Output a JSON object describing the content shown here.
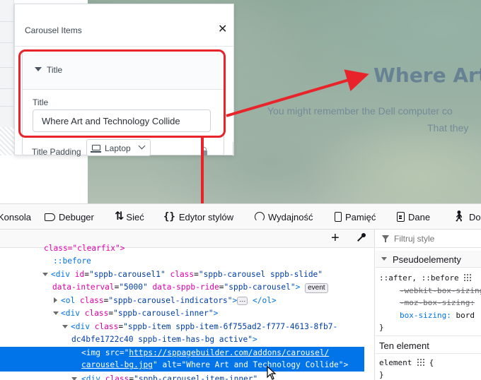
{
  "preview": {
    "hero_title": "Where Art a",
    "hero_sub_1": "You might remember the Dell computer co",
    "hero_sub_2": "That they"
  },
  "panel": {
    "title": "Carousel Items",
    "close_icon": "close-icon",
    "group_label": "Title",
    "field_label": "Title",
    "title_value": "Where Art and Technology Collide",
    "padding_label": "Title Padding",
    "device_label": "Laptop"
  },
  "colors": {
    "highlight_red": "#e8232a",
    "selection_blue": "#0074e8",
    "tag_blue": "#0074e8",
    "attr_pink": "#dd00a9",
    "value_navy": "#003eaa"
  },
  "devtools": {
    "tabs": [
      {
        "label": "Konsola",
        "icon": "console-icon"
      },
      {
        "label": "Debuger",
        "icon": "debugger-icon"
      },
      {
        "label": "Sieć",
        "icon": "network-icon"
      },
      {
        "label": "Edytor stylów",
        "icon": "style-editor-icon"
      },
      {
        "label": "Wydajność",
        "icon": "performance-icon"
      },
      {
        "label": "Pamięć",
        "icon": "memory-icon"
      },
      {
        "label": "Dane",
        "icon": "storage-icon"
      },
      {
        "label": "Do",
        "icon": "accessibility-icon"
      }
    ],
    "markup": {
      "l0": "class=\"clearfix\">",
      "l1": "::before",
      "l2_tag": "<div",
      "l2_a1": "id",
      "l2_v1": "\"sppb-carousel1\"",
      "l2_a2": "class",
      "l2_v2": "\"sppb-carousel sppb-slide\"",
      "l3_a1": "data-interval",
      "l3_v1": "\"5000\"",
      "l3_a2": "data-sppb-ride",
      "l3_v2": "\"sppb-carousel\"",
      "l3_end": ">",
      "l3_badge": "event",
      "l4_tag": "<ol",
      "l4_a": "class",
      "l4_v": "\"sppb-carousel-indicators\"",
      "l4_gt": ">",
      "l4_dots": "⋯",
      "l4_close": "</ol>",
      "l5_tag": "<div",
      "l5_a": "class",
      "l5_v": "\"sppb-carousel-inner\"",
      "l5_gt": ">",
      "l6_tag": "<div",
      "l6_a": "class",
      "l6_v": "\"sppb-item sppb-item-6f755ad2-f777-4613-8fb7-",
      "l7_v": "dc4bfe1722c40 sppb-item-has-bg active\"",
      "l7_gt": ">",
      "l8_tag": "<img",
      "l8_a": "src",
      "l8_eq": "=\"",
      "l8_link": "https://sppagebuilder.com/addons/carousel/",
      "l9_link": "carousel-bg.jpg",
      "l9_q": "\"",
      "l9_a": "alt",
      "l9_v": "\"Where Art and Technology Collide\"",
      "l9_gt": ">",
      "l10_tag": "<div",
      "l10_a": "class",
      "l10_v": "\"sppb-carousel-item-inner\""
    },
    "rules": {
      "filter_placeholder": "Filtruj style",
      "pseudo_header": "Pseudoelementy",
      "pseudo_selector": "::after, ::before",
      "decl1": "-webkit-box-sizing",
      "decl2": "-moz-box-sizing:",
      "decl3_prop": "box-sizing:",
      "decl3_val": "bord",
      "close_brace": "}",
      "element_header": "Ten element",
      "element_selector": "element",
      "open_brace": "{",
      "close_brace2": "}"
    }
  }
}
